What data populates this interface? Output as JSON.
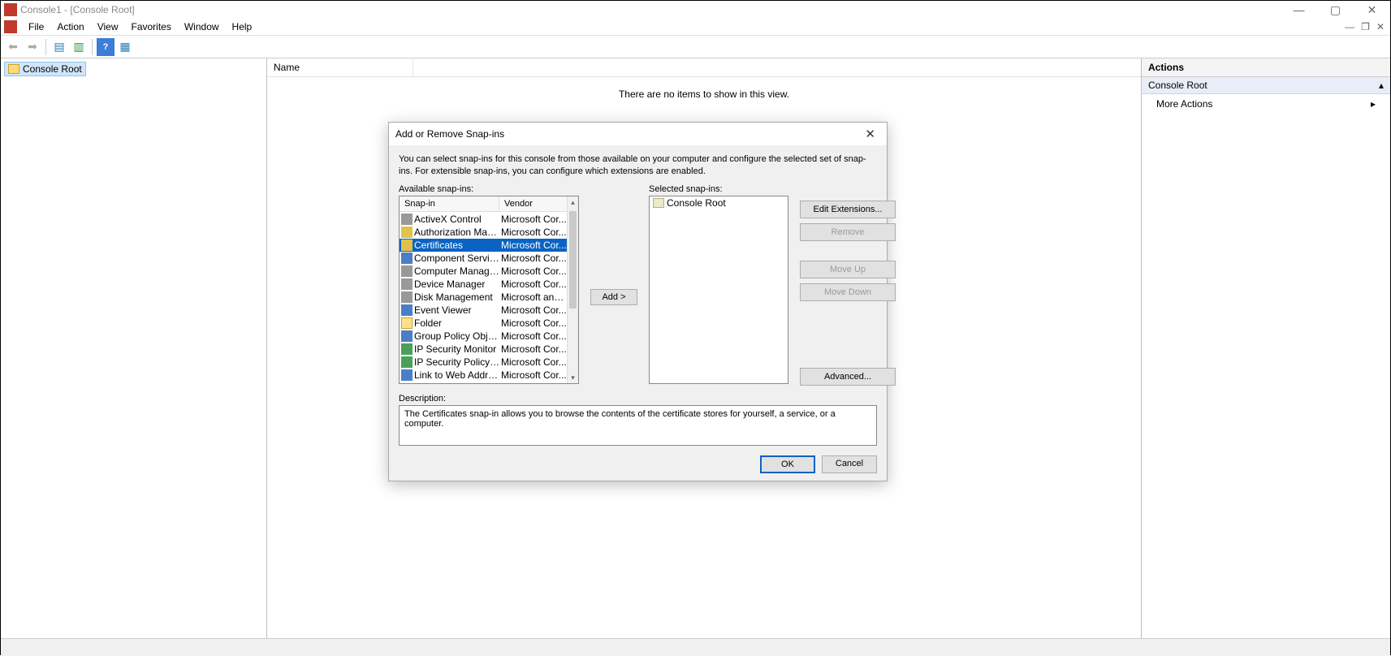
{
  "window": {
    "title": "Console1 - [Console Root]"
  },
  "menu": {
    "file": "File",
    "action": "Action",
    "view": "View",
    "favorites": "Favorites",
    "window": "Window",
    "help": "Help"
  },
  "tree": {
    "root": "Console Root"
  },
  "list": {
    "col_name": "Name",
    "empty": "There are no items to show in this view."
  },
  "actions": {
    "heading": "Actions",
    "section": "Console Root",
    "more": "More Actions"
  },
  "dialog": {
    "title": "Add or Remove Snap-ins",
    "intro": "You can select snap-ins for this console from those available on your computer and configure the selected set of snap-ins. For extensible snap-ins, you can configure which extensions are enabled.",
    "available_label": "Available snap-ins:",
    "selected_label": "Selected snap-ins:",
    "col_snapin": "Snap-in",
    "col_vendor": "Vendor",
    "add": "Add >",
    "edit_ext": "Edit Extensions...",
    "remove": "Remove",
    "move_up": "Move Up",
    "move_down": "Move Down",
    "advanced": "Advanced...",
    "description_label": "Description:",
    "description": "The Certificates snap-in allows you to browse the contents of the certificate stores for yourself, a service, or a computer.",
    "ok": "OK",
    "cancel": "Cancel",
    "selected_root": "Console Root",
    "available": [
      {
        "name": "ActiveX Control",
        "vendor": "Microsoft Cor...",
        "iconClass": "ic-grey"
      },
      {
        "name": "Authorization Manager",
        "vendor": "Microsoft Cor...",
        "iconClass": "ic-yellow"
      },
      {
        "name": "Certificates",
        "vendor": "Microsoft Cor...",
        "iconClass": "ic-yellow",
        "selected": true
      },
      {
        "name": "Component Services",
        "vendor": "Microsoft Cor...",
        "iconClass": "ic-blue"
      },
      {
        "name": "Computer Managem...",
        "vendor": "Microsoft Cor...",
        "iconClass": "ic-grey"
      },
      {
        "name": "Device Manager",
        "vendor": "Microsoft Cor...",
        "iconClass": "ic-grey"
      },
      {
        "name": "Disk Management",
        "vendor": "Microsoft and...",
        "iconClass": "ic-grey"
      },
      {
        "name": "Event Viewer",
        "vendor": "Microsoft Cor...",
        "iconClass": "ic-blue"
      },
      {
        "name": "Folder",
        "vendor": "Microsoft Cor...",
        "iconClass": "ic-folder"
      },
      {
        "name": "Group Policy Object ...",
        "vendor": "Microsoft Cor...",
        "iconClass": "ic-blue"
      },
      {
        "name": "IP Security Monitor",
        "vendor": "Microsoft Cor...",
        "iconClass": "ic-green"
      },
      {
        "name": "IP Security Policy M...",
        "vendor": "Microsoft Cor...",
        "iconClass": "ic-green"
      },
      {
        "name": "Link to Web Address",
        "vendor": "Microsoft Cor...",
        "iconClass": "ic-blue"
      }
    ]
  }
}
